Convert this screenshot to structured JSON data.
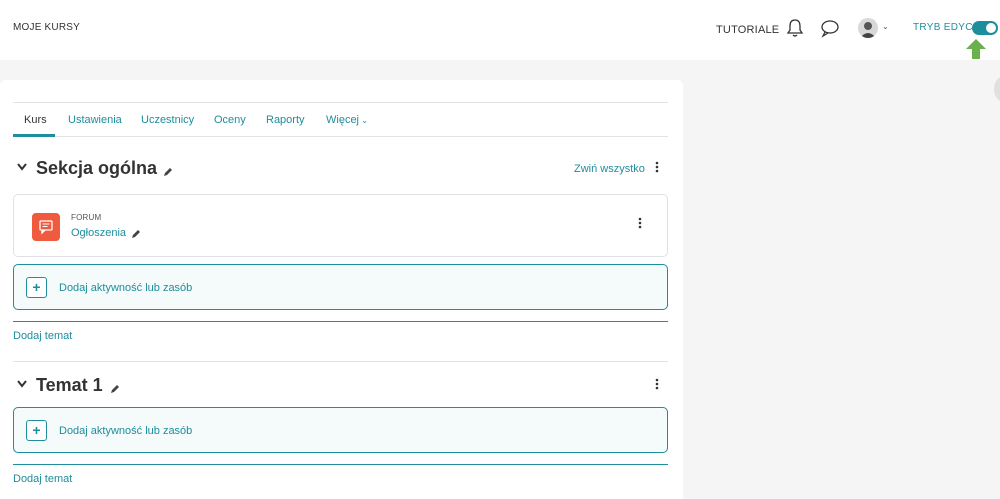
{
  "navbar": {
    "brand": "MOJE KURSY",
    "tutorials": "TUTORIALE",
    "edit_mode_label": "TRYB EDYCJI",
    "edit_mode_on": true
  },
  "tabs": [
    {
      "label": "Kurs",
      "active": true
    },
    {
      "label": "Ustawienia"
    },
    {
      "label": "Uczestnicy"
    },
    {
      "label": "Oceny"
    },
    {
      "label": "Raporty"
    },
    {
      "label": "Więcej"
    }
  ],
  "sections": [
    {
      "title": "Sekcja ogólna",
      "collapse_all": "Zwiń wszystko",
      "activity": {
        "type": "FORUM",
        "name": "Ogłoszenia"
      },
      "add_activity": "Dodaj aktywność lub zasób",
      "add_topic": "Dodaj temat"
    },
    {
      "title": "Temat 1",
      "add_activity": "Dodaj aktywność lub zasób",
      "add_topic": "Dodaj temat"
    }
  ],
  "colors": {
    "accent": "#1e8e9c",
    "forum_icon": "#f05a3e",
    "arrow": "#6ab04c"
  },
  "icons": [
    "bell-icon",
    "chat-icon",
    "avatar",
    "chevron-down-icon",
    "pencil-icon",
    "kebab-menu-icon",
    "forum-icon",
    "plus-icon",
    "up-arrow-icon"
  ]
}
